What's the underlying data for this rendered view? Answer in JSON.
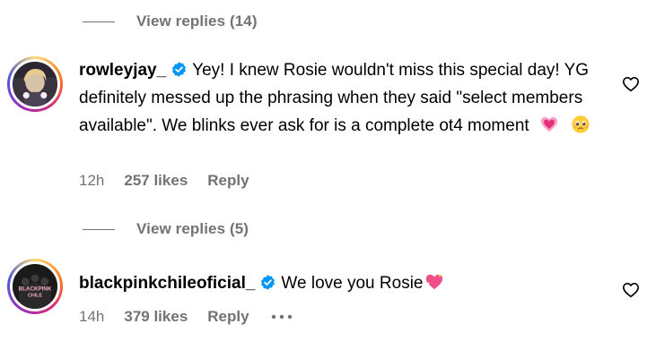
{
  "thread1": {
    "view_replies": "View replies (14)"
  },
  "comment1": {
    "username": "rowleyjay_",
    "text": "Yey! I knew Rosie wouldn't miss this special day! YG definitely messed up the phrasing when they said \"select members available\". We blinks ever ask for is a complete ot4 moment",
    "emojis": [
      "pink-heart-emoji",
      "pleading-face-emoji"
    ],
    "time": "12h",
    "likes": "257 likes",
    "reply": "Reply",
    "view_replies": "View replies (5)"
  },
  "comment2": {
    "username": "blackpinkchileoficial_",
    "text": "We love you Rosie",
    "avatar_text_line1": "BLACKPINK",
    "avatar_text_line2": "CHILE",
    "emojis": [
      "sparkling-heart-emoji"
    ],
    "time": "14h",
    "likes": "379 likes",
    "reply": "Reply"
  },
  "colors": {
    "muted_text": "#737373",
    "verified_blue": "#0095f6",
    "text": "#000000"
  }
}
